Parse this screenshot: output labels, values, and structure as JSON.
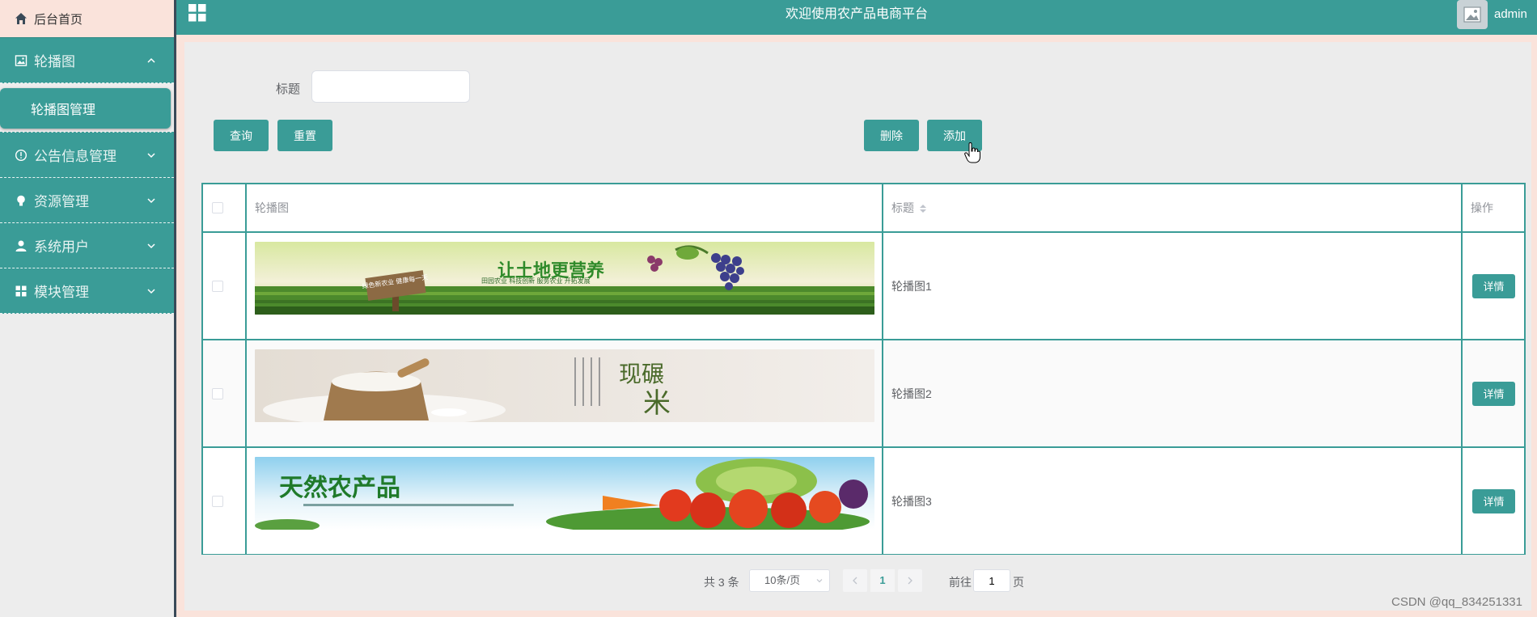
{
  "sidebar": {
    "home": "后台首页",
    "groups": [
      {
        "title": "轮播图",
        "icon": "image-icon",
        "expanded": true,
        "items": [
          "轮播图管理"
        ]
      },
      {
        "title": "公告信息管理",
        "icon": "info-circle-icon",
        "expanded": false
      },
      {
        "title": "资源管理",
        "icon": "bulb-icon",
        "expanded": false
      },
      {
        "title": "系统用户",
        "icon": "user-icon",
        "expanded": false
      },
      {
        "title": "模块管理",
        "icon": "grid-icon",
        "expanded": false
      }
    ]
  },
  "header": {
    "title": "欢迎使用农产品电商平台",
    "user": "admin"
  },
  "search": {
    "title_label": "标题",
    "title_value": "",
    "query_label": "查询",
    "reset_label": "重置",
    "delete_label": "删除",
    "add_label": "添加"
  },
  "table": {
    "columns": [
      "轮播图",
      "标题",
      "操作"
    ],
    "rows": [
      {
        "banner": "banner-grapes-field",
        "title": "轮播图1",
        "action": "详情"
      },
      {
        "banner": "banner-rice-sack",
        "title": "轮播图2",
        "action": "详情"
      },
      {
        "banner": "banner-vegetables",
        "title": "轮播图3",
        "action": "详情"
      }
    ]
  },
  "banners": {
    "b1_text": "让土地更营养",
    "b1_sign": "绿色新农业 健康每一天",
    "b1_sub": "田园农业 科技创新 服务农业 开拓发展",
    "b2_text": "现碾",
    "b2_text2": "米",
    "b3_text": "天然农产品"
  },
  "pagination": {
    "total": "共 3 条",
    "page_size": "10条/页",
    "current": "1",
    "goto_label": "前往",
    "goto_value": "1",
    "page_unit": "页"
  },
  "colors": {
    "accent": "#3a9c97",
    "sidebar_bg": "#ededed",
    "page_bg": "#fae3db"
  },
  "watermark": "CSDN @qq_834251331"
}
